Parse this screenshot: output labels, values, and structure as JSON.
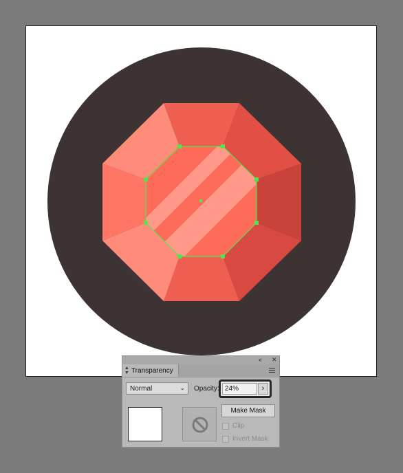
{
  "canvas": {
    "icon_name": "octagon-gem-icon",
    "colors": {
      "circle": "#3e3333",
      "gem_light": "#ff8c7a",
      "gem_mid": "#ef5f51",
      "gem_dark": "#c9433b",
      "gem_center": "#ff6b59",
      "gem_stripe": "#ff9a8b",
      "selection": "#59e14d"
    }
  },
  "panel": {
    "collapse_icon": "«",
    "close_icon": "✕",
    "tab_label": "Transparency",
    "blend_mode": "Normal",
    "opacity_label": "Opacity:",
    "opacity_value": "24%",
    "opacity_arrow": "›",
    "make_mask_label": "Make Mask",
    "clip_label": "Clip",
    "invert_mask_label": "Invert Mask"
  }
}
